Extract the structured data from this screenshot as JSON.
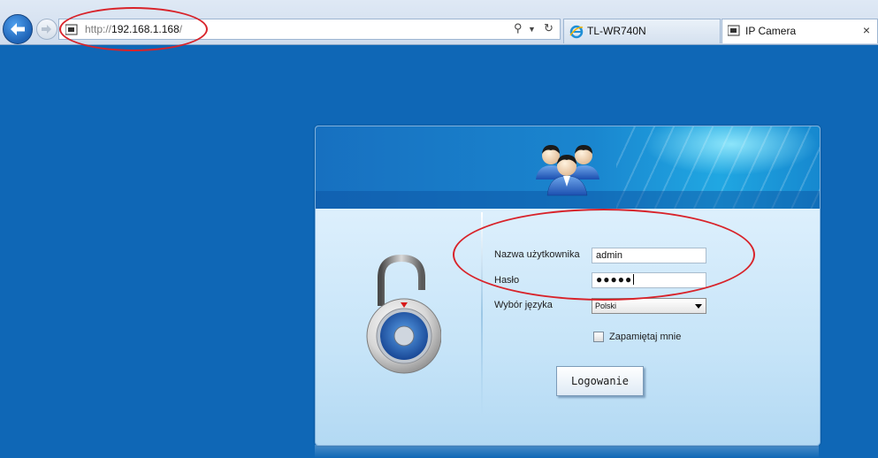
{
  "browser": {
    "url_scheme": "http://",
    "url_host": "192.168.1.168",
    "url_path": "/",
    "tabs": [
      {
        "label": "TL-WR740N",
        "active": false
      },
      {
        "label": "IP Camera",
        "active": true
      }
    ],
    "close_glyph": "×"
  },
  "login": {
    "username_label": "Nazwa użytkownika",
    "username_value": "admin",
    "password_label": "Hasło",
    "password_mask": "●●●●●",
    "language_label": "Wybór języka",
    "language_selected": "Polski",
    "remember_label": "Zapamiętaj mnie",
    "remember_checked": false,
    "submit_label": "Logowanie"
  },
  "colors": {
    "page_background": "#0f67b6",
    "annotation_red": "#d8232a",
    "banner_blue": "#1a86cf"
  },
  "icons": [
    "back-arrow-icon",
    "forward-arrow-icon",
    "site-camera-icon",
    "search-icon",
    "refresh-icon",
    "ie-icon",
    "users-icon",
    "padlock-icon"
  ]
}
